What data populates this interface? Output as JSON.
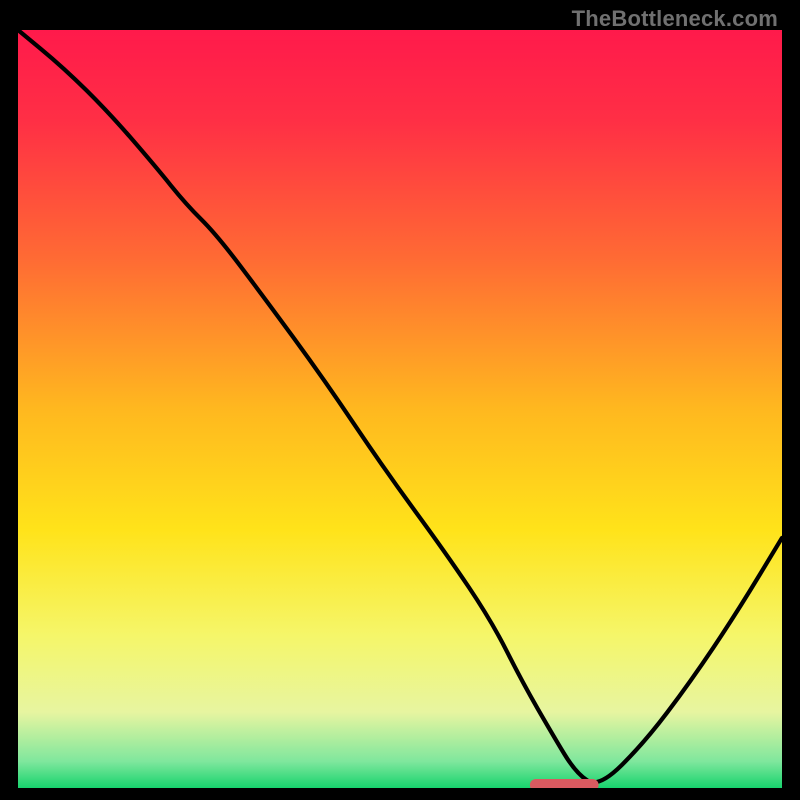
{
  "watermark": "TheBottleneck.com",
  "chart_data": {
    "type": "line",
    "title": "",
    "xlabel": "",
    "ylabel": "",
    "xlim": [
      0,
      100
    ],
    "ylim": [
      0,
      100
    ],
    "gradient_stops": [
      {
        "offset": 0.0,
        "color": "#ff1a4b"
      },
      {
        "offset": 0.12,
        "color": "#ff2f45"
      },
      {
        "offset": 0.3,
        "color": "#ff6a34"
      },
      {
        "offset": 0.5,
        "color": "#ffb81f"
      },
      {
        "offset": 0.66,
        "color": "#ffe31a"
      },
      {
        "offset": 0.8,
        "color": "#f5f66a"
      },
      {
        "offset": 0.9,
        "color": "#e7f5a0"
      },
      {
        "offset": 0.965,
        "color": "#7fe79d"
      },
      {
        "offset": 1.0,
        "color": "#17d36d"
      }
    ],
    "series": [
      {
        "name": "bottleneck-curve",
        "x": [
          0,
          6,
          12,
          18,
          22,
          26,
          32,
          40,
          48,
          56,
          62,
          66,
          70,
          73,
          76,
          82,
          88,
          94,
          100
        ],
        "y": [
          100,
          95,
          89,
          82,
          77,
          73,
          65,
          54,
          42,
          31,
          22,
          14,
          7,
          2,
          0,
          6,
          14,
          23,
          33
        ]
      }
    ],
    "marker": {
      "name": "sweet-spot",
      "x_start": 67,
      "x_end": 76,
      "y": 0.4,
      "color": "#d95a60"
    }
  }
}
